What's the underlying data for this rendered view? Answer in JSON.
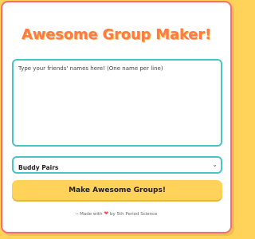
{
  "app": {
    "title": "Awesome Group Maker!"
  },
  "names_input": {
    "placeholder": "Type your friends' names here! (One name per line)",
    "value": ""
  },
  "group_select": {
    "selected": "Buddy Pairs"
  },
  "make_button": {
    "label": "Make Awesome Groups!"
  },
  "footer": {
    "prefix": "-- Made with",
    "suffix": "by 5th Period Science"
  },
  "icons": {
    "heart": "heart-icon",
    "chevron": "chevron-down-icon"
  },
  "colors": {
    "background": "#ffd25a",
    "card_border": "#ff6a74",
    "title": "#ff7a45",
    "input_border": "#49c5c6",
    "button": "#ffd25a",
    "heart": "#ff4d5a"
  }
}
